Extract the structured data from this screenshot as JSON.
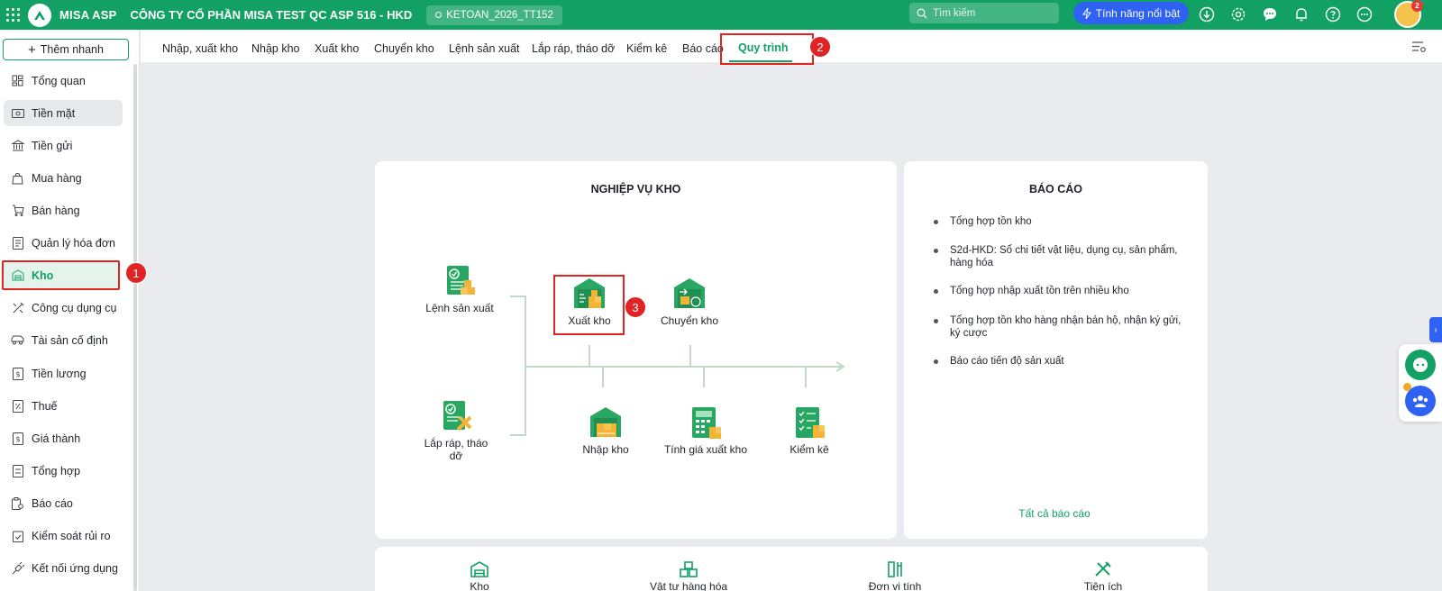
{
  "topbar": {
    "app_name": "MISA ASP",
    "company": "CÔNG TY CỔ PHẦN MISA TEST QC ASP 516 - HKD",
    "database": "KETOAN_2026_TT152",
    "search_placeholder": "Tìm kiếm",
    "feature_button": "Tính năng nổi bật",
    "notification_count": "2",
    "icons": [
      "download-icon",
      "gear-icon",
      "chat-icon",
      "bell-icon",
      "help-icon",
      "more-icon"
    ]
  },
  "sidebar": {
    "add_branch": "Thêm nhanh",
    "items": [
      {
        "label": "Tổng quan",
        "icon": "dashboard-icon"
      },
      {
        "label": "Tiền mặt",
        "icon": "cash-icon"
      },
      {
        "label": "Tiền gửi",
        "icon": "bank-icon"
      },
      {
        "label": "Mua hàng",
        "icon": "shopping-bag-icon"
      },
      {
        "label": "Bán hàng",
        "icon": "cart-icon"
      },
      {
        "label": "Quản lý hóa đơn",
        "icon": "invoice-icon"
      },
      {
        "label": "Kho",
        "icon": "warehouse-icon"
      },
      {
        "label": "Công cụ dụng cụ",
        "icon": "tools-icon"
      },
      {
        "label": "Tài sản cố định",
        "icon": "car-icon"
      },
      {
        "label": "Tiền lương",
        "icon": "salary-icon"
      },
      {
        "label": "Thuế",
        "icon": "tax-icon"
      },
      {
        "label": "Giá thành",
        "icon": "cost-icon"
      },
      {
        "label": "Tổng hợp",
        "icon": "summary-icon"
      },
      {
        "label": "Báo cáo",
        "icon": "report-icon"
      },
      {
        "label": "Kiểm soát rủi ro",
        "icon": "risk-icon"
      },
      {
        "label": "Kết nối ứng dụng",
        "icon": "plug-icon"
      }
    ]
  },
  "tabs": [
    "Nhập, xuất kho",
    "Nhập kho",
    "Xuất kho",
    "Chuyển kho",
    "Lệnh sản xuất",
    "Lắp ráp, tháo dỡ",
    "Kiểm kê",
    "Báo cáo",
    "Quy trình"
  ],
  "steps": [
    "1",
    "2",
    "3"
  ],
  "process": {
    "title": "NGHIỆP VỤ KHO",
    "production_order": "Lệnh sản xuất",
    "assembly": "Lắp ráp, tháo dỡ",
    "stock_out": "Xuất kho",
    "transfer": "Chuyển kho",
    "stock_in": "Nhập kho",
    "cost_calc": "Tính giá xuất kho",
    "inventory_check": "Kiểm kê"
  },
  "reports": {
    "title": "BÁO CÁO",
    "items": [
      "Tổng hợp tồn kho",
      "S2d-HKD: Sổ chi tiết vật liệu, dụng cụ, sản phẩm, hàng hóa",
      "Tổng hợp nhập xuất tồn trên nhiều kho",
      "Tổng hợp tồn kho hàng nhận bán hộ, nhận ký gửi, ký cược",
      "Báo cáo tiến độ sản xuất"
    ],
    "all_link": "Tất cả báo cáo"
  },
  "bottom": [
    "Kho",
    "Vật tư hàng hóa",
    "Đơn vị tính",
    "Tiện ích"
  ],
  "colors": {
    "brand": "#13a065",
    "accent": "#2f62f2",
    "highlight": "#e02424"
  }
}
